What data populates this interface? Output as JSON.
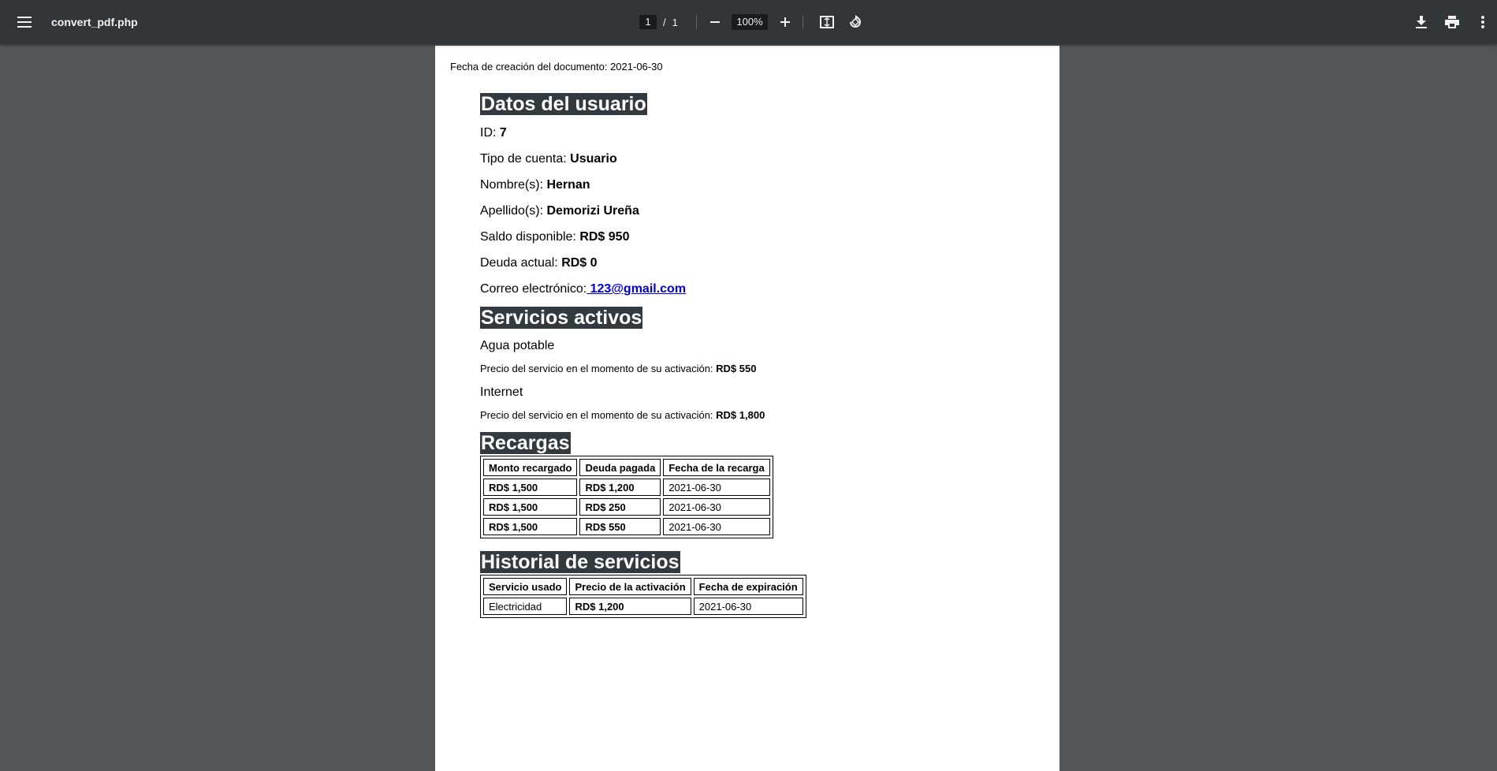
{
  "viewer": {
    "file_name": "convert_pdf.php",
    "current_page": "1",
    "page_separator": "/",
    "total_pages": "1",
    "zoom": "100%",
    "icons": {
      "menu": "menu-icon",
      "zoom_out": "minus-icon",
      "zoom_in": "plus-icon",
      "fit_page": "fit-to-page-icon",
      "rotate": "rotate-icon",
      "download": "download-icon",
      "print": "print-icon",
      "more": "more-vertical-icon"
    }
  },
  "document": {
    "creation_date": "Fecha de creación del documento: 2021-06-30",
    "user_section": {
      "title": "Datos del usuario",
      "fields": [
        {
          "label": "ID: ",
          "value": "7"
        },
        {
          "label": "Tipo de cuenta: ",
          "value": "Usuario"
        },
        {
          "label": "Nombre(s): ",
          "value": "Hernan"
        },
        {
          "label": "Apellido(s): ",
          "value": "Demorizi Ureña"
        },
        {
          "label": "Saldo disponible: ",
          "value": "RD$ 950"
        },
        {
          "label": "Deuda actual: ",
          "value": "RD$ 0"
        }
      ],
      "email_label": "Correo electrónico:",
      "email_value": " 123@gmail.com"
    },
    "services_section": {
      "title": "Servicios activos",
      "price_label": "Precio del servicio en el momento de su activación: ",
      "services": [
        {
          "name": "Agua potable",
          "price": "RD$ 550"
        },
        {
          "name": "Internet",
          "price": "RD$ 1,800"
        }
      ]
    },
    "recharges_section": {
      "title": "Recargas",
      "headers": [
        "Monto recargado",
        "Deuda pagada",
        "Fecha de la recarga"
      ],
      "rows": [
        [
          "RD$ 1,500",
          "RD$ 1,200",
          "2021-06-30"
        ],
        [
          "RD$ 1,500",
          "RD$ 250",
          "2021-06-30"
        ],
        [
          "RD$ 1,500",
          "RD$ 550",
          "2021-06-30"
        ]
      ]
    },
    "history_section": {
      "title": "Historial de servicios",
      "headers": [
        "Servicio usado",
        "Precio de la activación",
        "Fecha de expiración"
      ],
      "rows": [
        [
          "Electricidad",
          "RD$ 1,200",
          "2021-06-30"
        ]
      ]
    }
  }
}
